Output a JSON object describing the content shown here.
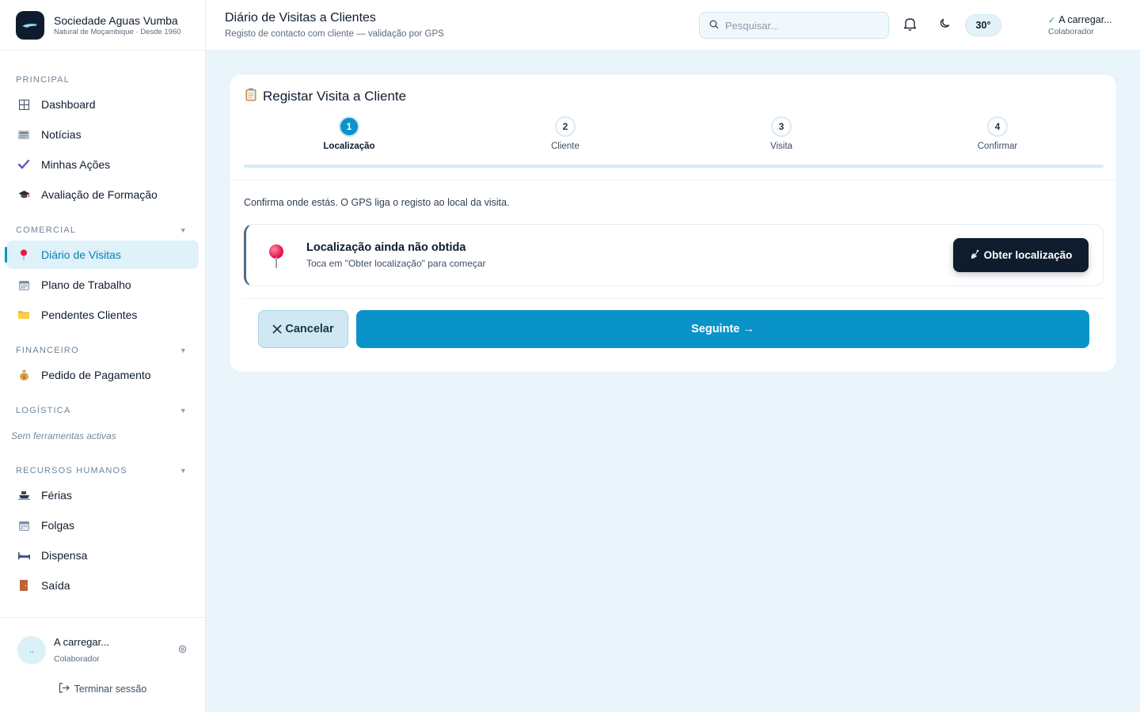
{
  "brand": {
    "name": "Sociedade Aguas Vumba",
    "tagline": "Natural de Moçambique · Desde 1960"
  },
  "sidebar": {
    "sections": [
      {
        "label": "PRINCIPAL",
        "collapsible": false,
        "items": [
          {
            "label": "Dashboard",
            "icon": "grid-icon"
          },
          {
            "label": "Notícias",
            "icon": "newspaper-icon"
          },
          {
            "label": "Minhas Ações",
            "icon": "check-icon"
          },
          {
            "label": "Avaliação de Formação",
            "icon": "graduation-cap-icon"
          }
        ]
      },
      {
        "label": "COMERCIAL",
        "collapsible": true,
        "items": [
          {
            "label": "Diário de Visitas",
            "icon": "pin-icon",
            "active": true
          },
          {
            "label": "Plano de Trabalho",
            "icon": "calendar-icon"
          },
          {
            "label": "Pendentes Clientes",
            "icon": "folder-icon"
          }
        ]
      },
      {
        "label": "FINANCEIRO",
        "collapsible": true,
        "items": [
          {
            "label": "Pedido de Pagamento",
            "icon": "money-bag-icon"
          }
        ]
      },
      {
        "label": "LOGÍSTICA",
        "collapsible": true,
        "empty_text": "Sem ferramentas activas"
      },
      {
        "label": "RECURSOS HUMANOS",
        "collapsible": true,
        "items": [
          {
            "label": "Férias",
            "icon": "ship-icon"
          },
          {
            "label": "Folgas",
            "icon": "calendar-icon"
          },
          {
            "label": "Dispensa",
            "icon": "bed-icon"
          },
          {
            "label": "Saída",
            "icon": "door-icon"
          }
        ]
      }
    ],
    "footer": {
      "avatar_text": "..",
      "user_name": "A carregar...",
      "user_role": "Colaborador",
      "logout_label": "Terminar sessão"
    }
  },
  "header": {
    "title": "Diário de Visitas a Clientes",
    "subtitle": "Registo de contacto com cliente — validação por GPS",
    "search_placeholder": "Pesquisar...",
    "temperature": "30°",
    "user_name": "A carregar...",
    "user_role": "Colaborador"
  },
  "card": {
    "title": "Registar Visita a Cliente",
    "steps": [
      {
        "number": "1",
        "label": "Localização",
        "active": true
      },
      {
        "number": "2",
        "label": "Cliente"
      },
      {
        "number": "3",
        "label": "Visita"
      },
      {
        "number": "4",
        "label": "Confirmar"
      }
    ],
    "progress": 0,
    "hint": "Confirma onde estás. O GPS liga o registo ao local da visita.",
    "location": {
      "title": "Localização ainda não obtida",
      "subtitle": "Toca em \"Obter localização\" para começar",
      "button": "Obter localização"
    },
    "cancel_label": "Cancelar",
    "next_label": "Seguinte →"
  },
  "colors": {
    "accent": "#0a93c9",
    "dark": "#0f1c2e",
    "background": "#e9f4fb"
  }
}
